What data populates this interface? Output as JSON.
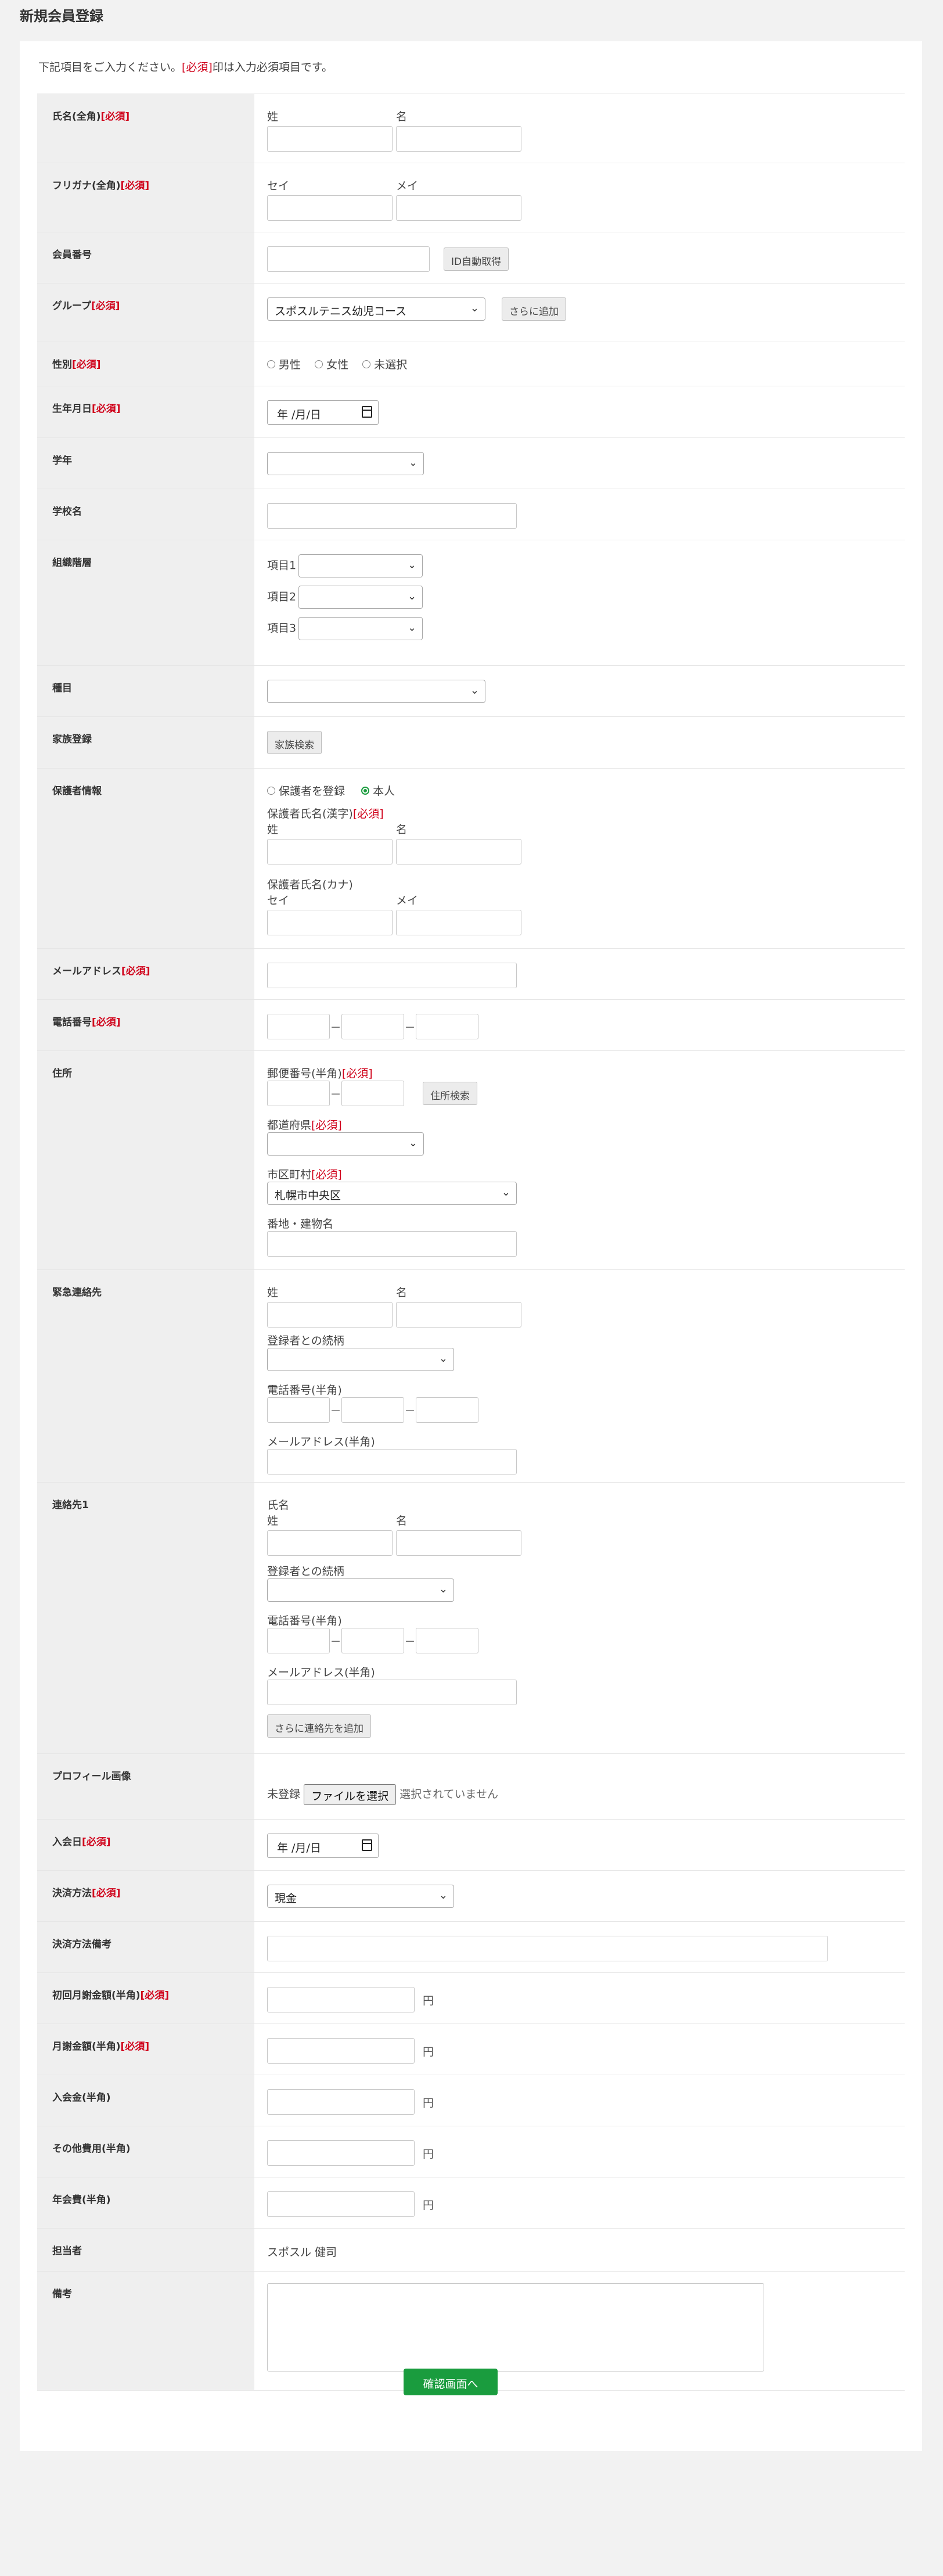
{
  "page_title": "新規会員登録",
  "intro": {
    "before": "下記項目をご入力ください。",
    "req": "[必須]",
    "after": "印は入力必須項目です。"
  },
  "required": "[必須]",
  "labels": {
    "name": "氏名(全角)",
    "kana": "フリガナ(全角)",
    "member_no": "会員番号",
    "group": "グループ",
    "gender": "性別",
    "birthday": "生年月日",
    "grade": "学年",
    "school": "学校名",
    "org": "組織階層",
    "category": "種目",
    "family": "家族登録",
    "guardian": "保護者情報",
    "email": "メールアドレス",
    "phone": "電話番号",
    "address": "住所",
    "emergency": "緊急連絡先",
    "contact1": "連絡先1",
    "profile_image": "プロフィール画像",
    "join_date": "入会日",
    "payment": "決済方法",
    "payment_note": "決済方法備考",
    "first_fee": "初回月謝金額(半角)",
    "monthly_fee": "月謝金額(半角)",
    "admission_fee": "入会金(半角)",
    "other_fee": "その他費用(半角)",
    "annual_fee": "年会費(半角)",
    "staff": "担当者",
    "note": "備考"
  },
  "fields": {
    "sei": "姓",
    "mei": "名",
    "sei_kana": "セイ",
    "mei_kana": "メイ",
    "auto_id_button": "ID自動取得",
    "group_selected": "スポスルテニス幼児コース",
    "add_more_button": "さらに追加",
    "gender_options": [
      "男性",
      "女性",
      "未選択"
    ],
    "date_placeholder": "年 /月/日",
    "org_items": [
      "項目1",
      "項目2",
      "項目3"
    ],
    "family_search_button": "家族検索",
    "guardian_radio_1": "保護者を登録",
    "guardian_radio_2": "本人",
    "guardian_name_kanji": "保護者氏名(漢字)",
    "guardian_name_kana": "保護者氏名(カナ)",
    "postal_code": "郵便番号(半角)",
    "address_search_button": "住所検索",
    "prefecture": "都道府県",
    "city": "市区町村",
    "city_selected": "札幌市中央区",
    "street": "番地・建物名",
    "relation": "登録者との続柄",
    "phone_half": "電話番号(半角)",
    "email_half": "メールアドレス(半角)",
    "contact_name": "氏名",
    "add_contact_button": "さらに連絡先を追加",
    "unregistered": "未登録",
    "file_button": "ファイルを選択",
    "file_none": "選択されていません",
    "payment_selected": "現金",
    "yen": "円",
    "staff_value": "スポスル 健司",
    "dash": "－"
  },
  "submit_button": "確認画面へ"
}
